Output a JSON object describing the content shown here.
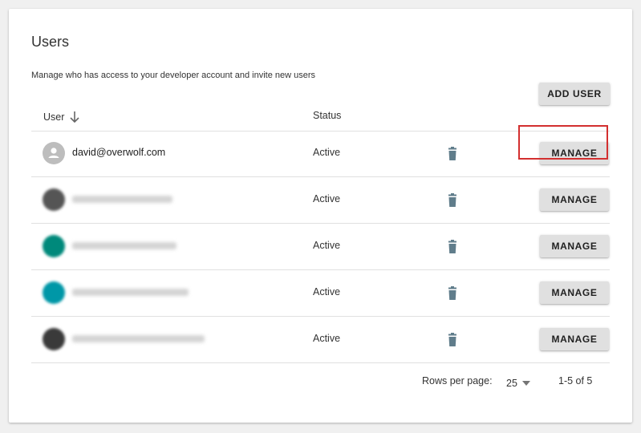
{
  "title": "Users",
  "subtitle": "Manage who has access to your developer account and invite new users",
  "add_user_label": "ADD USER",
  "columns": {
    "user": "User",
    "status": "Status"
  },
  "rows": [
    {
      "email": "david@overwolf.com",
      "status": "Active",
      "manage_label": "MANAGE",
      "avatar_color": "#bdbdbd"
    },
    {
      "email": "",
      "status": "Active",
      "manage_label": "MANAGE",
      "avatar_color": "#555555"
    },
    {
      "email": "",
      "status": "Active",
      "manage_label": "MANAGE",
      "avatar_color": "#00897b"
    },
    {
      "email": "",
      "status": "Active",
      "manage_label": "MANAGE",
      "avatar_color": "#0097a7"
    },
    {
      "email": "",
      "status": "Active",
      "manage_label": "MANAGE",
      "avatar_color": "#3a3a3a"
    }
  ],
  "pagination": {
    "rows_per_page_label": "Rows per page:",
    "rows_per_page_value": "25",
    "range_label": "1-5 of 5"
  },
  "icons": {
    "sort": "arrow-down-icon",
    "delete": "trash-icon",
    "dropdown": "caret-down-icon",
    "avatar": "person-icon"
  },
  "colors": {
    "button_bg": "#e0e0e0",
    "trash": "#607d8b",
    "highlight": "#d32f2f"
  }
}
